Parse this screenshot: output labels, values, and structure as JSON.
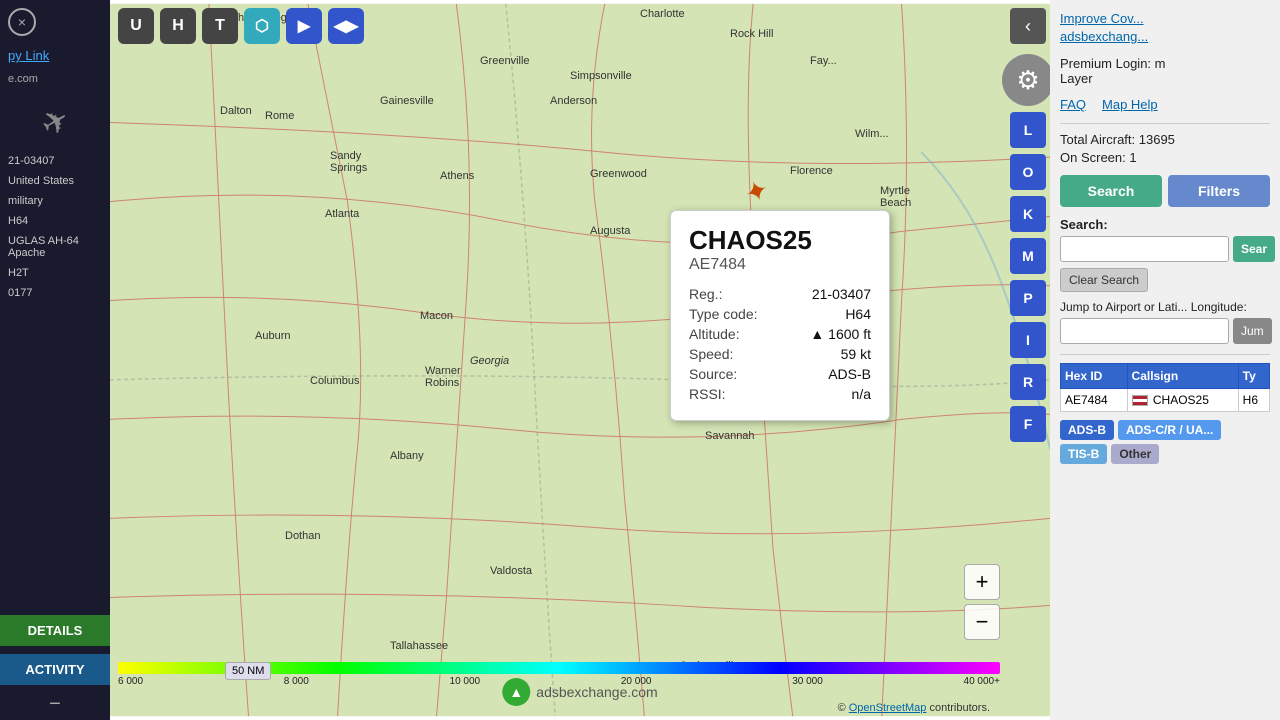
{
  "left_panel": {
    "close_btn": "×",
    "link_text": "py Link",
    "url": "e.com",
    "aircraft_icon": "✈",
    "reg": "21-03407",
    "country": "United States",
    "category": "military",
    "type": "H64",
    "name": "UGLAS AH-64 Apache",
    "squawk": "H2T",
    "mode_s": "0177",
    "details_btn": "DETAILS",
    "activity_btn": "ACTIVITY",
    "minus": "−"
  },
  "top_nav": {
    "btn_u": "U",
    "btn_h": "H",
    "btn_t": "T",
    "btn_layers": "⬡",
    "btn_next": "▶",
    "btn_swap": "◀▶"
  },
  "popup": {
    "callsign": "CHAOS25",
    "hex": "AE7484",
    "reg_label": "Reg.:",
    "reg_value": "21-03407",
    "type_label": "Type code:",
    "type_value": "H64",
    "alt_label": "Altitude:",
    "alt_indicator": "▲",
    "alt_value": "1600 ft",
    "speed_label": "Speed:",
    "speed_value": "59 kt",
    "source_label": "Source:",
    "source_value": "ADS-B",
    "rssi_label": "RSSI:",
    "rssi_value": "n/a"
  },
  "map_sidebar": {
    "btn_back": "‹",
    "btn_l": "L",
    "btn_o": "O",
    "btn_k": "K",
    "btn_m": "M",
    "btn_p": "P",
    "btn_i": "I",
    "btn_r": "R",
    "btn_f": "F"
  },
  "alt_bar": {
    "labels": [
      "6 000",
      "8 000",
      "10 000",
      "20 000",
      "30 000",
      "40 000+"
    ]
  },
  "range_label": "50 NM",
  "watermark": "adsbexchange.com",
  "attribution": "© OpenStreetMap contributors.",
  "right_panel": {
    "link1": "Improve Cov...",
    "link2": "adsbexchang...",
    "premium_label": "Premium Login: m",
    "layer_label": "Layer",
    "faq_label": "FAQ",
    "map_help_label": "Map Help",
    "total_label": "Total Aircraft:",
    "total_value": "13695",
    "on_screen_label": "On Screen:",
    "on_screen_value": "1",
    "search_btn": "Search",
    "filters_btn": "Filters",
    "search_label": "Search:",
    "search_placeholder": "",
    "search_go": "Sear",
    "clear_search_btn": "Clear Search",
    "jump_label": "Jump to Airport or Lati... Longitude:",
    "jump_placeholder": "",
    "jump_btn": "Jum",
    "table_headers": [
      "Hex ID",
      "Callsign",
      "Ty"
    ],
    "table_rows": [
      {
        "hex": "AE7484",
        "flag": "us",
        "callsign": "CHAOS25",
        "type": "H6"
      }
    ],
    "source_tags": [
      "ADS-B",
      "ADS-C/R / UA...",
      "TIS-B",
      "Other"
    ]
  }
}
